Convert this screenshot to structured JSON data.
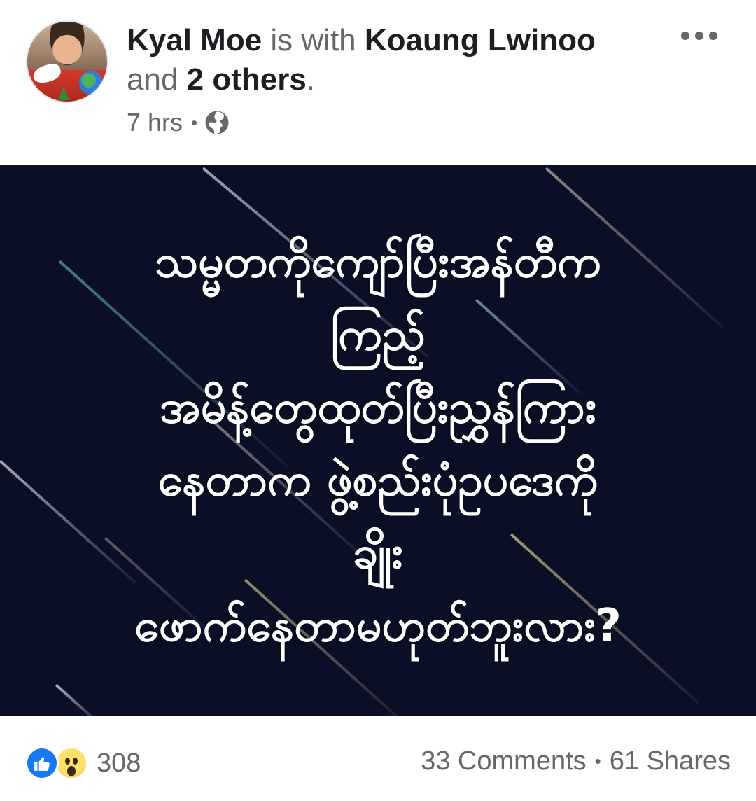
{
  "header": {
    "author": "Kyal Moe",
    "with_text": "is with",
    "tagged_friend": "Koaung Lwinoo",
    "and_text": "and",
    "others": "2 others",
    "period": ".",
    "timestamp": "7 hrs",
    "separator": "•",
    "privacy_icon": "globe-icon",
    "more_icon": "more-options-icon"
  },
  "image": {
    "lines": [
      "သမ္မတကိုကျော်ပြီးအန်တီက",
      "ကြည့်",
      "အမိန့်တွေထုတ်ပြီးညွှန်ကြား",
      "နေတာက  ဖွဲ့စည်းပုံဥပဒေကို",
      "ချိုး",
      "ဖောက်နေတာမဟုတ်ဘူးလား?"
    ],
    "background_color": "#0b0f26"
  },
  "footer": {
    "reaction_icons": [
      "like-icon",
      "wow-icon"
    ],
    "reaction_count": "308",
    "comments": "33 Comments",
    "separator": "•",
    "shares": "61 Shares"
  },
  "colors": {
    "brand_blue": "#1877f2",
    "text_primary": "#1c1e21",
    "text_secondary": "#65676b"
  }
}
